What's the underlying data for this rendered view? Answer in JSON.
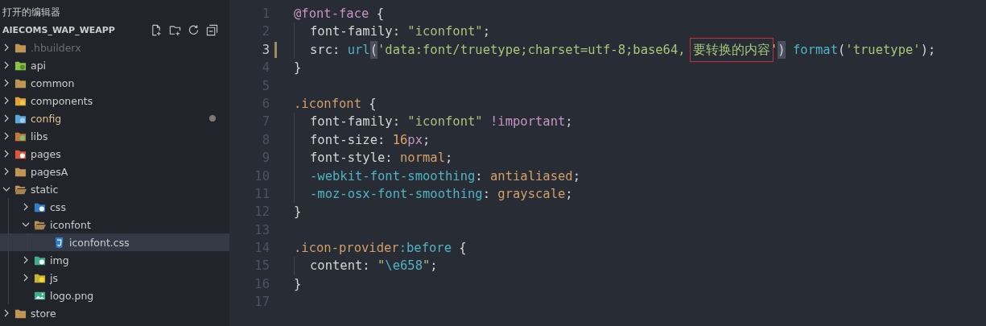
{
  "sidebar": {
    "open_editors_title": "打开的编辑器",
    "project_title": "AIECOMS_WAP_WEAPP",
    "toolbar": [
      {
        "kind": "new-file"
      },
      {
        "kind": "new-folder"
      },
      {
        "kind": "refresh"
      },
      {
        "kind": "collapse"
      }
    ],
    "tree": [
      {
        "label": ".hbuilderx",
        "kind": "folder",
        "expanded": false,
        "dimmed": true,
        "modified": false,
        "selected": false
      },
      {
        "label": "api",
        "kind": "folder-api",
        "expanded": false,
        "dimmed": false,
        "modified": false,
        "selected": false
      },
      {
        "label": "common",
        "kind": "folder",
        "expanded": false,
        "dimmed": false,
        "modified": false,
        "selected": false
      },
      {
        "label": "components",
        "kind": "folder-components",
        "expanded": false,
        "dimmed": false,
        "modified": false,
        "selected": false
      },
      {
        "label": "config",
        "kind": "folder-config",
        "expanded": false,
        "dimmed": false,
        "modified": true,
        "selected": false
      },
      {
        "label": "libs",
        "kind": "folder-libs",
        "expanded": false,
        "dimmed": false,
        "modified": false,
        "selected": false
      },
      {
        "label": "pages",
        "kind": "folder-pages",
        "expanded": false,
        "dimmed": false,
        "modified": false,
        "selected": false
      },
      {
        "label": "pagesA",
        "kind": "folder",
        "expanded": false,
        "dimmed": false,
        "modified": false,
        "selected": false
      },
      {
        "label": "static",
        "kind": "folder",
        "expanded": true,
        "dimmed": false,
        "modified": false,
        "selected": false,
        "children": [
          {
            "label": "css",
            "kind": "folder-css",
            "expanded": false,
            "dimmed": false,
            "modified": false,
            "selected": false
          },
          {
            "label": "iconfont",
            "kind": "folder",
            "expanded": true,
            "dimmed": false,
            "modified": false,
            "selected": false,
            "children": [
              {
                "label": "iconfont.css",
                "kind": "file-css",
                "dimmed": false,
                "modified": false,
                "selected": true
              }
            ]
          },
          {
            "label": "img",
            "kind": "folder-img",
            "expanded": false,
            "dimmed": false,
            "modified": false,
            "selected": false
          },
          {
            "label": "js",
            "kind": "folder-js",
            "expanded": false,
            "dimmed": false,
            "modified": false,
            "selected": false
          },
          {
            "label": "logo.png",
            "kind": "file-image",
            "dimmed": false,
            "modified": false,
            "selected": false
          }
        ]
      },
      {
        "label": "store",
        "kind": "folder",
        "expanded": false,
        "dimmed": false,
        "modified": false,
        "selected": false
      }
    ]
  },
  "editor": {
    "lines": [
      {
        "number": "1",
        "current": false,
        "modified": false,
        "indented": false,
        "tokens": [
          {
            "text": "@font-face",
            "kind": "at"
          },
          {
            "text": " {",
            "kind": "punct"
          }
        ]
      },
      {
        "number": "2",
        "current": false,
        "modified": false,
        "indented": true,
        "tokens": [
          {
            "text": "font-family",
            "kind": "prop"
          },
          {
            "text": ": ",
            "kind": "punct"
          },
          {
            "text": "\"iconfont\"",
            "kind": "string"
          },
          {
            "text": ";",
            "kind": "punct"
          }
        ]
      },
      {
        "number": "3",
        "current": true,
        "modified": true,
        "indented": true,
        "tokens": [
          {
            "text": "src",
            "kind": "prop"
          },
          {
            "text": ": ",
            "kind": "punct"
          },
          {
            "text": "url",
            "kind": "func"
          },
          {
            "text": "(",
            "kind": "punct",
            "matched": true
          },
          {
            "text": "'data:font/truetype;charset=utf-8;base64, ",
            "kind": "string"
          },
          {
            "text": "要转换的内容",
            "kind": "string",
            "boxed": true
          },
          {
            "text": "'",
            "kind": "string"
          },
          {
            "text": ")",
            "kind": "punct",
            "matched": true
          },
          {
            "text": " format",
            "kind": "func"
          },
          {
            "text": "(",
            "kind": "punct"
          },
          {
            "text": "'truetype'",
            "kind": "string"
          },
          {
            "text": ");",
            "kind": "punct"
          }
        ]
      },
      {
        "number": "4",
        "current": false,
        "modified": false,
        "indented": false,
        "tokens": [
          {
            "text": "}",
            "kind": "punct"
          }
        ]
      },
      {
        "number": "5",
        "current": false,
        "modified": false,
        "indented": false
      },
      {
        "number": "6",
        "current": false,
        "modified": false,
        "indented": false,
        "tokens": [
          {
            "text": ".iconfont",
            "kind": "selector"
          },
          {
            "text": " {",
            "kind": "punct"
          }
        ]
      },
      {
        "number": "7",
        "current": false,
        "modified": false,
        "indented": true,
        "tokens": [
          {
            "text": "font-family",
            "kind": "prop"
          },
          {
            "text": ": ",
            "kind": "punct"
          },
          {
            "text": "\"iconfont\" ",
            "kind": "string"
          },
          {
            "text": "!important",
            "kind": "at"
          },
          {
            "text": ";",
            "kind": "punct"
          }
        ]
      },
      {
        "number": "8",
        "current": false,
        "modified": false,
        "indented": true,
        "tokens": [
          {
            "text": "font-size",
            "kind": "prop"
          },
          {
            "text": ": ",
            "kind": "punct"
          },
          {
            "text": "16",
            "kind": "number"
          },
          {
            "text": "px",
            "kind": "at"
          },
          {
            "text": ";",
            "kind": "punct"
          }
        ]
      },
      {
        "number": "9",
        "current": false,
        "modified": false,
        "indented": true,
        "tokens": [
          {
            "text": "font-style",
            "kind": "prop"
          },
          {
            "text": ": ",
            "kind": "punct"
          },
          {
            "text": "normal",
            "kind": "value"
          },
          {
            "text": ";",
            "kind": "punct"
          }
        ]
      },
      {
        "number": "10",
        "current": false,
        "modified": false,
        "indented": true,
        "tokens": [
          {
            "text": "-webkit-font-smoothing",
            "kind": "func"
          },
          {
            "text": ": ",
            "kind": "punct"
          },
          {
            "text": "antialiased",
            "kind": "value"
          },
          {
            "text": ";",
            "kind": "punct"
          }
        ]
      },
      {
        "number": "11",
        "current": false,
        "modified": false,
        "indented": true,
        "tokens": [
          {
            "text": "-moz-osx-font-smoothing",
            "kind": "func"
          },
          {
            "text": ": ",
            "kind": "punct"
          },
          {
            "text": "grayscale",
            "kind": "value"
          },
          {
            "text": ";",
            "kind": "punct"
          }
        ]
      },
      {
        "number": "12",
        "current": false,
        "modified": false,
        "indented": false,
        "tokens": [
          {
            "text": "}",
            "kind": "punct"
          }
        ]
      },
      {
        "number": "13",
        "current": false,
        "modified": false,
        "indented": false
      },
      {
        "number": "14",
        "current": false,
        "modified": false,
        "indented": false,
        "tokens": [
          {
            "text": ".icon-provider",
            "kind": "selector"
          },
          {
            "text": ":before",
            "kind": "func"
          },
          {
            "text": " {",
            "kind": "punct"
          }
        ]
      },
      {
        "number": "15",
        "current": false,
        "modified": false,
        "indented": true,
        "tokens": [
          {
            "text": "content",
            "kind": "prop"
          },
          {
            "text": ": ",
            "kind": "punct"
          },
          {
            "text": "\"",
            "kind": "string"
          },
          {
            "text": "\\e658",
            "kind": "func"
          },
          {
            "text": "\"",
            "kind": "string"
          },
          {
            "text": ";",
            "kind": "punct"
          }
        ]
      },
      {
        "number": "16",
        "current": false,
        "modified": false,
        "indented": false,
        "tokens": [
          {
            "text": "}",
            "kind": "punct"
          }
        ]
      },
      {
        "number": "17",
        "current": false,
        "modified": false,
        "indented": false
      }
    ]
  }
}
